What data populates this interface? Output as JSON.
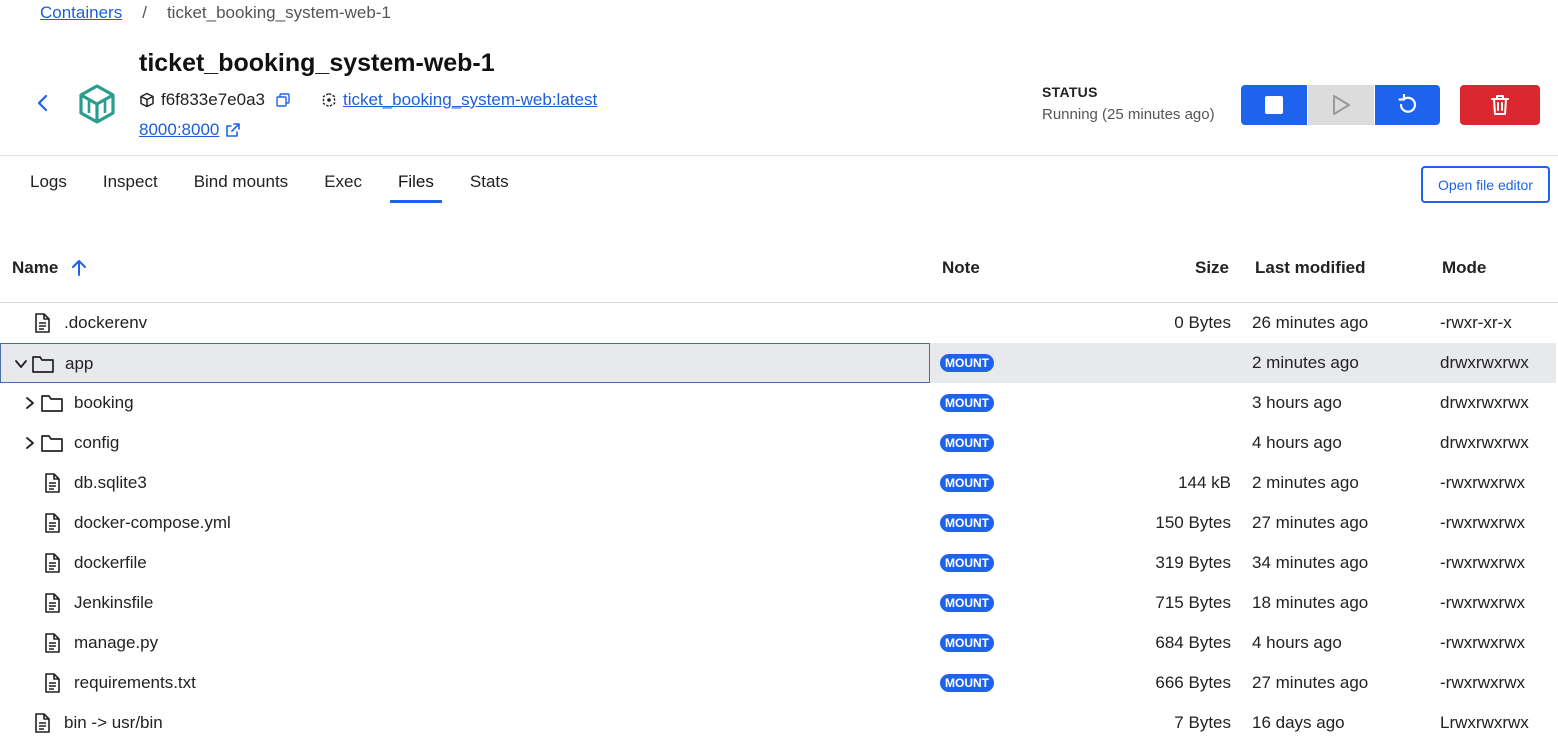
{
  "breadcrumb": {
    "root": "Containers",
    "separator": "/",
    "current": "ticket_booking_system-web-1"
  },
  "container": {
    "name": "ticket_booking_system-web-1",
    "id": "f6f833e7e0a3",
    "image": "ticket_booking_system-web:latest",
    "port": "8000:8000"
  },
  "status": {
    "label": "STATUS",
    "value": "Running (25 minutes ago)"
  },
  "colors": {
    "primary": "#1d63ed",
    "danger": "#d9262f",
    "link": "#1f5fd6"
  },
  "tabs": [
    {
      "label": "Logs"
    },
    {
      "label": "Inspect"
    },
    {
      "label": "Bind mounts"
    },
    {
      "label": "Exec"
    },
    {
      "label": "Files",
      "active": true
    },
    {
      "label": "Stats"
    }
  ],
  "open_editor_label": "Open file editor",
  "table": {
    "headers": {
      "name": "Name",
      "note": "Note",
      "size": "Size",
      "modified": "Last modified",
      "mode": "Mode"
    },
    "rows": [
      {
        "name": ".dockerenv",
        "type": "file",
        "depth": 0,
        "note": "",
        "size": "0 Bytes",
        "modified": "26 minutes ago",
        "mode": "-rwxr-xr-x"
      },
      {
        "name": "app",
        "type": "folder",
        "depth": 0,
        "expanded": true,
        "selected": true,
        "note": "MOUNT",
        "size": "",
        "modified": "2 minutes ago",
        "mode": "drwxrwxrwx"
      },
      {
        "name": "booking",
        "type": "folder",
        "depth": 1,
        "expanded": false,
        "note": "MOUNT",
        "size": "",
        "modified": "3 hours ago",
        "mode": "drwxrwxrwx"
      },
      {
        "name": "config",
        "type": "folder",
        "depth": 1,
        "expanded": false,
        "note": "MOUNT",
        "size": "",
        "modified": "4 hours ago",
        "mode": "drwxrwxrwx"
      },
      {
        "name": "db.sqlite3",
        "type": "file",
        "depth": 1,
        "note": "MOUNT",
        "size": "144 kB",
        "modified": "2 minutes ago",
        "mode": "-rwxrwxrwx"
      },
      {
        "name": "docker-compose.yml",
        "type": "file",
        "depth": 1,
        "note": "MOUNT",
        "size": "150 Bytes",
        "modified": "27 minutes ago",
        "mode": "-rwxrwxrwx"
      },
      {
        "name": "dockerfile",
        "type": "file",
        "depth": 1,
        "note": "MOUNT",
        "size": "319 Bytes",
        "modified": "34 minutes ago",
        "mode": "-rwxrwxrwx"
      },
      {
        "name": "Jenkinsfile",
        "type": "file",
        "depth": 1,
        "note": "MOUNT",
        "size": "715 Bytes",
        "modified": "18 minutes ago",
        "mode": "-rwxrwxrwx"
      },
      {
        "name": "manage.py",
        "type": "file",
        "depth": 1,
        "note": "MOUNT",
        "size": "684 Bytes",
        "modified": "4 hours ago",
        "mode": "-rwxrwxrwx"
      },
      {
        "name": "requirements.txt",
        "type": "file",
        "depth": 1,
        "note": "MOUNT",
        "size": "666 Bytes",
        "modified": "27 minutes ago",
        "mode": "-rwxrwxrwx"
      },
      {
        "name": "bin -> usr/bin",
        "type": "file",
        "depth": 0,
        "note": "",
        "size": "7 Bytes",
        "modified": "16 days ago",
        "mode": "Lrwxrwxrwx"
      }
    ]
  }
}
